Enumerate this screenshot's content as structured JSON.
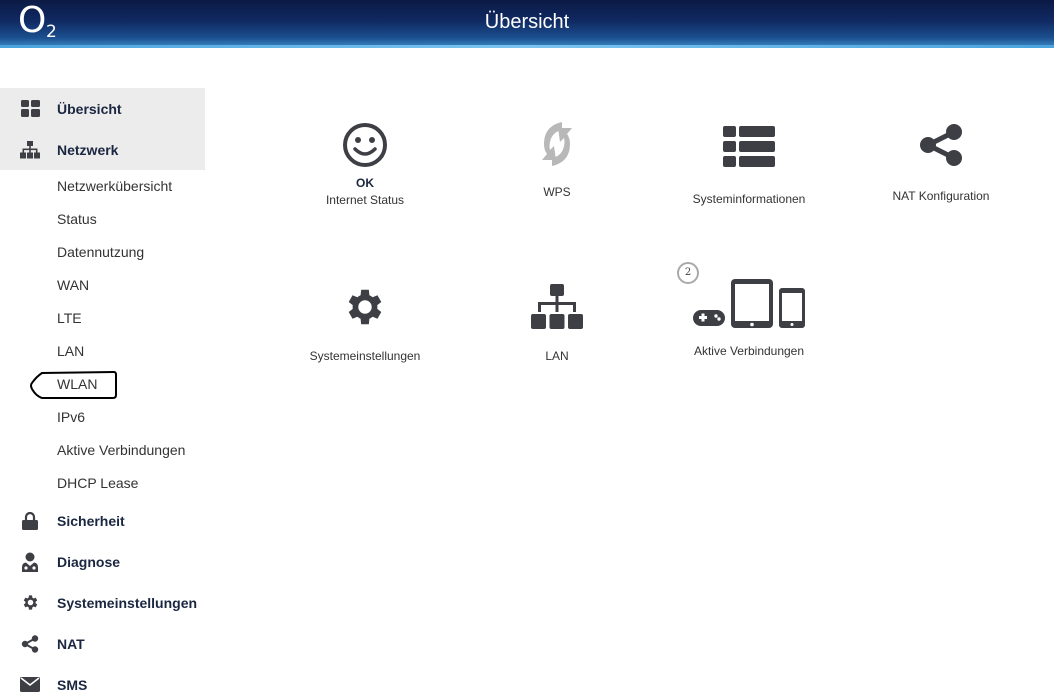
{
  "header": {
    "logo_letter": "O",
    "logo_sub": "2",
    "title": "Übersicht"
  },
  "sidebar": {
    "items": [
      {
        "label": "Übersicht",
        "icon": "grid-icon",
        "active": true
      },
      {
        "label": "Netzwerk",
        "icon": "network-icon",
        "active": true
      }
    ],
    "sub_items": [
      "Netzwerkübersicht",
      "Status",
      "Datennutzung",
      "WAN",
      "LTE",
      "LAN",
      "WLAN",
      "IPv6",
      "Aktive Verbindungen",
      "DHCP Lease"
    ],
    "bottom_items": [
      {
        "label": "Sicherheit",
        "icon": "lock-icon"
      },
      {
        "label": "Diagnose",
        "icon": "doctor-icon"
      },
      {
        "label": "Systemeinstellungen",
        "icon": "gear-icon"
      },
      {
        "label": "NAT",
        "icon": "share-icon"
      },
      {
        "label": "SMS",
        "icon": "envelope-icon"
      }
    ]
  },
  "tiles": {
    "internet_status": {
      "status": "OK",
      "label": "Internet Status",
      "icon": "smiley-icon"
    },
    "wps": {
      "label": "WPS",
      "icon": "wps-icon"
    },
    "systeminfo": {
      "label": "Systeminformationen",
      "icon": "list-icon"
    },
    "nat": {
      "label": "NAT Konfiguration",
      "icon": "share-icon"
    },
    "systemeinstellungen": {
      "label": "Systemeinstellungen",
      "icon": "gear-icon"
    },
    "lan": {
      "label": "LAN",
      "icon": "network-icon"
    },
    "aktive": {
      "label": "Aktive Verbindungen",
      "icon": "devices-icon",
      "badge": "2"
    }
  },
  "colors": {
    "header_dark": "#0b1a44",
    "header_light": "#3a86c4",
    "active_bg": "#ececec",
    "icon_color": "#3d3f44",
    "nav_text": "#1b2741"
  }
}
